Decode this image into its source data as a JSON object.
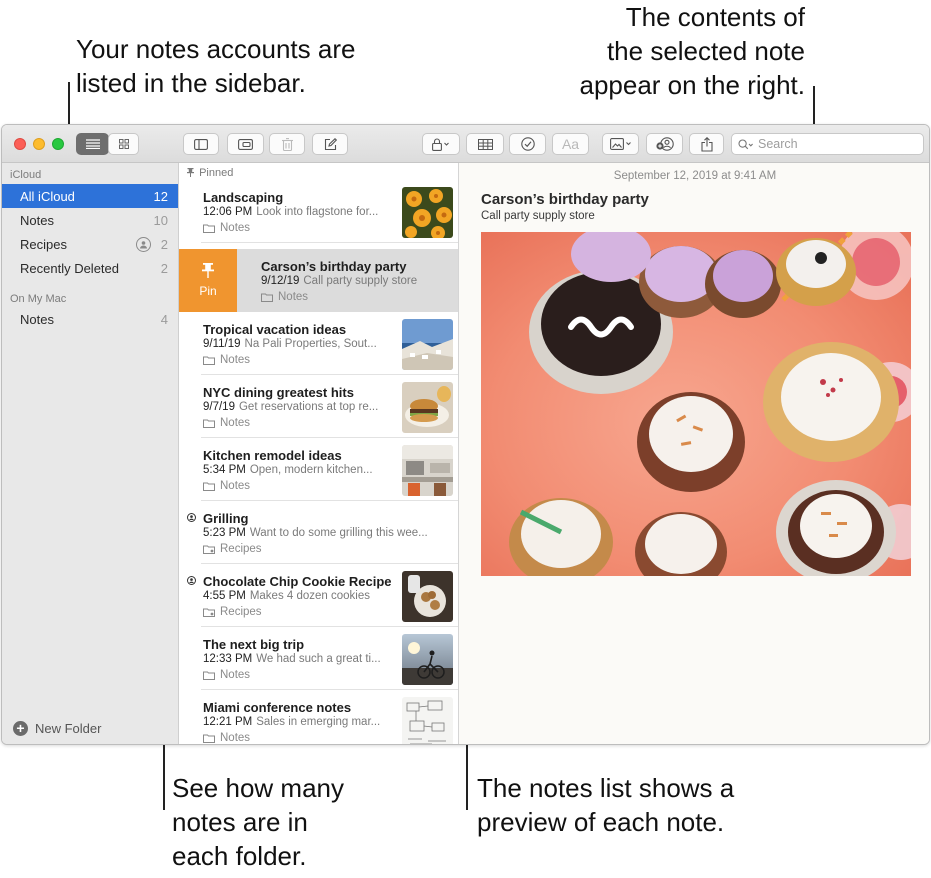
{
  "callouts": {
    "top_left": [
      "Your notes accounts are",
      "listed in the sidebar."
    ],
    "top_right": [
      "The contents of",
      "the selected note",
      "appear on the right."
    ],
    "bottom_left": [
      "See how many",
      "notes are in",
      "each folder."
    ],
    "bottom_right": [
      "The notes list shows a",
      "preview of each note."
    ]
  },
  "toolbar": {
    "search_placeholder": "Search",
    "font_button_label": "Aa",
    "icons": [
      "list-view-icon",
      "gallery-view-icon",
      "sidebar-toggle-icon",
      "attachments-icon",
      "trash-icon",
      "compose-icon",
      "lock-icon",
      "table-icon",
      "checklist-icon",
      "format-icon",
      "media-icon",
      "collaborate-icon",
      "share-icon",
      "search-icon"
    ]
  },
  "sidebar": {
    "sections": [
      {
        "title": "iCloud",
        "items": [
          {
            "label": "All iCloud",
            "count": "12",
            "selected": true
          },
          {
            "label": "Notes",
            "count": "10"
          },
          {
            "label": "Recipes",
            "count": "2",
            "shared": true
          },
          {
            "label": "Recently Deleted",
            "count": "2"
          }
        ]
      },
      {
        "title": "On My Mac",
        "items": [
          {
            "label": "Notes",
            "count": "4"
          }
        ]
      }
    ],
    "new_folder_label": "New Folder"
  },
  "notelist": {
    "pinned_label": "Pinned",
    "pin_action_label": "Pin",
    "notes": [
      {
        "title": "Landscaping",
        "time": "12:06 PM",
        "preview": "Look into flagstone for...",
        "folder": "Notes",
        "thumb": "flowers"
      },
      {
        "title": "Carson’s birthday party",
        "time": "9/12/19",
        "preview": "Call party supply store",
        "folder": "Notes",
        "selected": true
      },
      {
        "title": "Tropical vacation ideas",
        "time": "9/11/19",
        "preview": "Na Pali Properties, Sout...",
        "folder": "Notes",
        "thumb": "coast"
      },
      {
        "title": "NYC dining greatest hits",
        "time": "9/7/19",
        "preview": "Get reservations at top re...",
        "folder": "Notes",
        "thumb": "burger"
      },
      {
        "title": "Kitchen remodel ideas",
        "time": "5:34 PM",
        "preview": "Open, modern kitchen...",
        "folder": "Notes",
        "thumb": "kitchen"
      },
      {
        "title": "Grilling",
        "time": "5:23 PM",
        "preview": "Want to do some grilling this wee...",
        "folder": "Recipes",
        "shared": true
      },
      {
        "title": "Chocolate Chip Cookie Recipe",
        "time": "4:55 PM",
        "preview": "Makes 4 dozen cookies",
        "folder": "Recipes",
        "shared": true,
        "thumb": "cookies"
      },
      {
        "title": "The next big trip",
        "time": "12:33 PM",
        "preview": "We had such a great ti...",
        "folder": "Notes",
        "thumb": "bike"
      },
      {
        "title": "Miami conference notes",
        "time": "12:21 PM",
        "preview": "Sales in emerging mar...",
        "folder": "Notes",
        "thumb": "sketch"
      }
    ]
  },
  "detail": {
    "date": "September 12, 2019 at 9:41 AM",
    "title": "Carson’s birthday party",
    "body": "Call party supply store",
    "image": "cupcakes-photo"
  },
  "colors": {
    "selection_blue": "#2d72d9",
    "pin_orange": "#f0952f",
    "detail_background": "#fbfaf7"
  }
}
